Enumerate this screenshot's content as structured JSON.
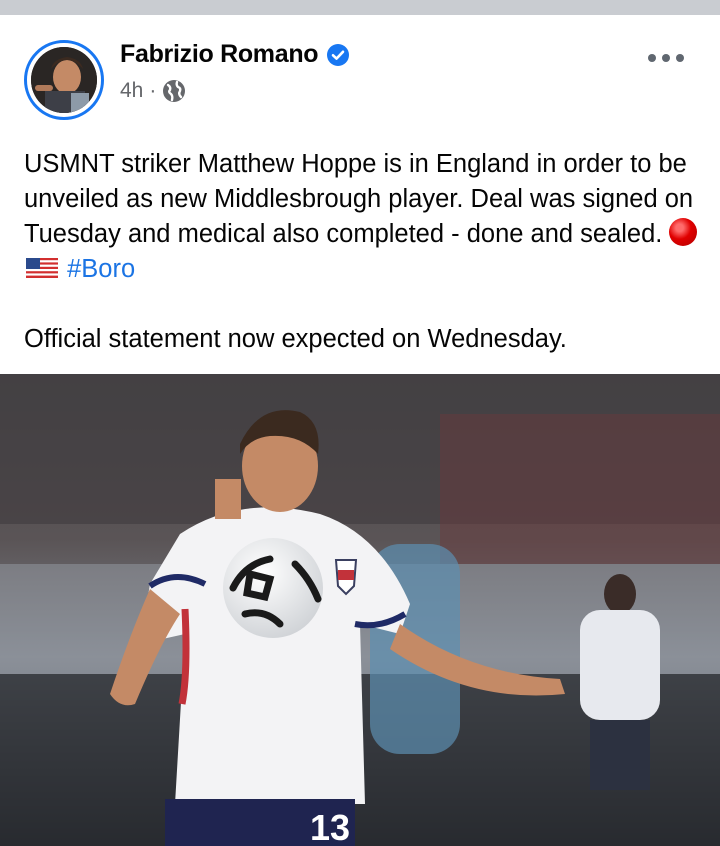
{
  "post": {
    "author": "Fabrizio Romano",
    "time": "4h",
    "separator": "·",
    "text_line_1": "USMNT striker Matthew Hoppe is in England in order to be unveiled as new Middlesbrough player. Deal was signed on Tuesday and medical also completed - done and sealed.",
    "hashtag": "#Boro",
    "text_line_2": "Official statement now expected on Wednesday.",
    "jersey_number": "13",
    "icons": [
      "verified-badge-icon",
      "globe-icon",
      "more-options-icon",
      "red-circle-emoji",
      "us-flag-emoji"
    ]
  },
  "colors": {
    "accent": "#1877f2",
    "hashtag": "#1b74e4",
    "meta": "#65676b",
    "topbar": "#c9ccd1"
  }
}
